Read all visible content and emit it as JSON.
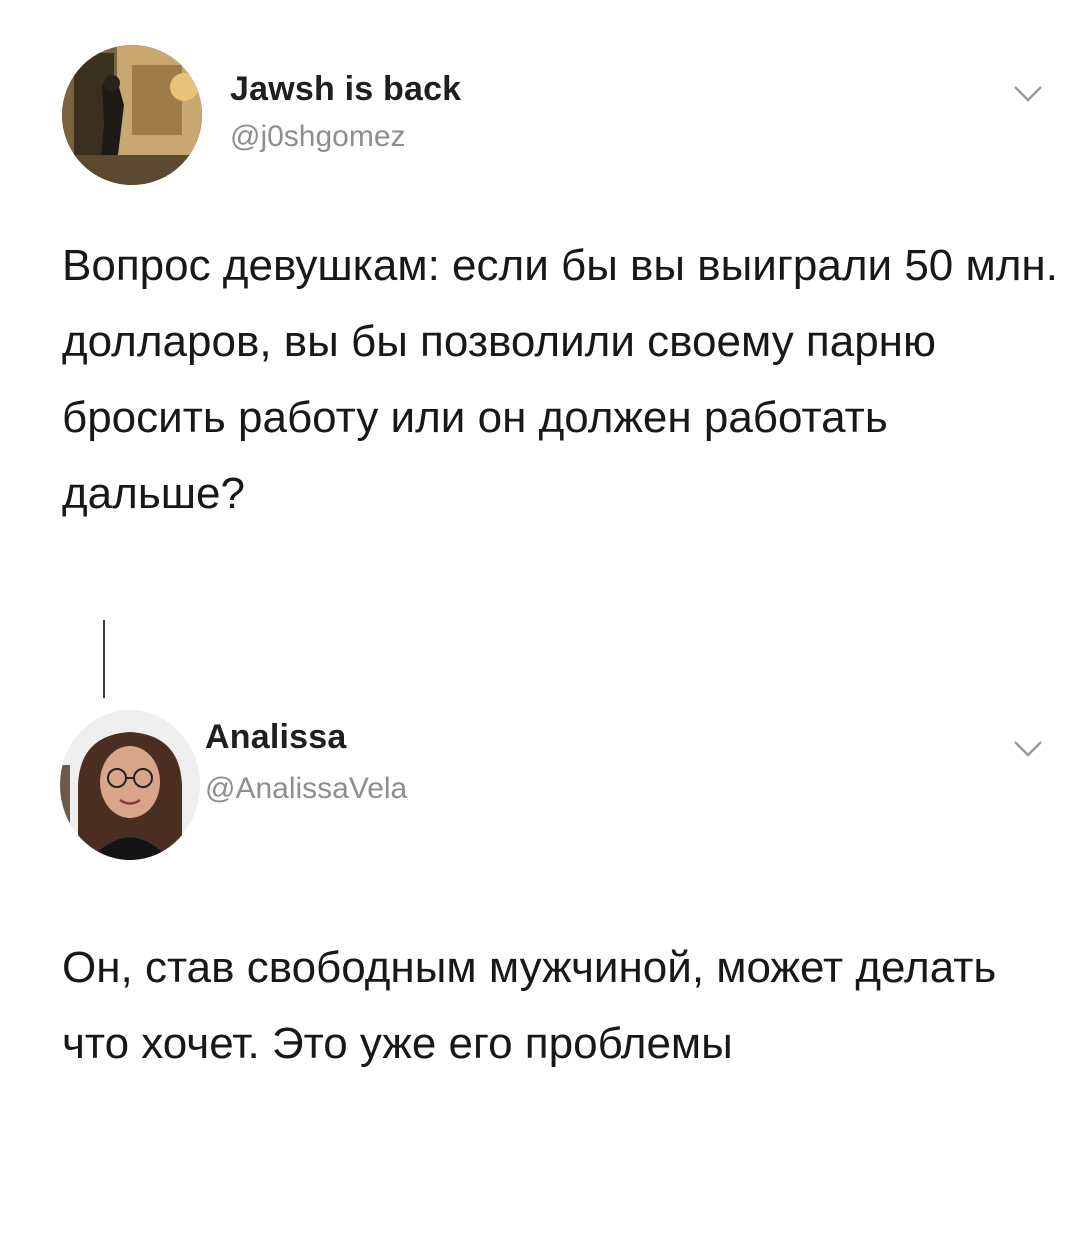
{
  "tweets": [
    {
      "display_name": "Jawsh is back",
      "handle": "@j0shgomez",
      "text": "Вопрос девушкам: если бы вы выиграли 50 млн. долларов, вы бы позволили своему парню бросить работу или он должен работать дальше?",
      "menu_icon": "chevron-down-icon"
    },
    {
      "display_name": "Analissa",
      "handle": "@AnalissaVela",
      "text": "Он, став свободным мужчиной, может делать что хочет. Это уже его проблемы",
      "menu_icon": "chevron-down-icon"
    }
  ]
}
